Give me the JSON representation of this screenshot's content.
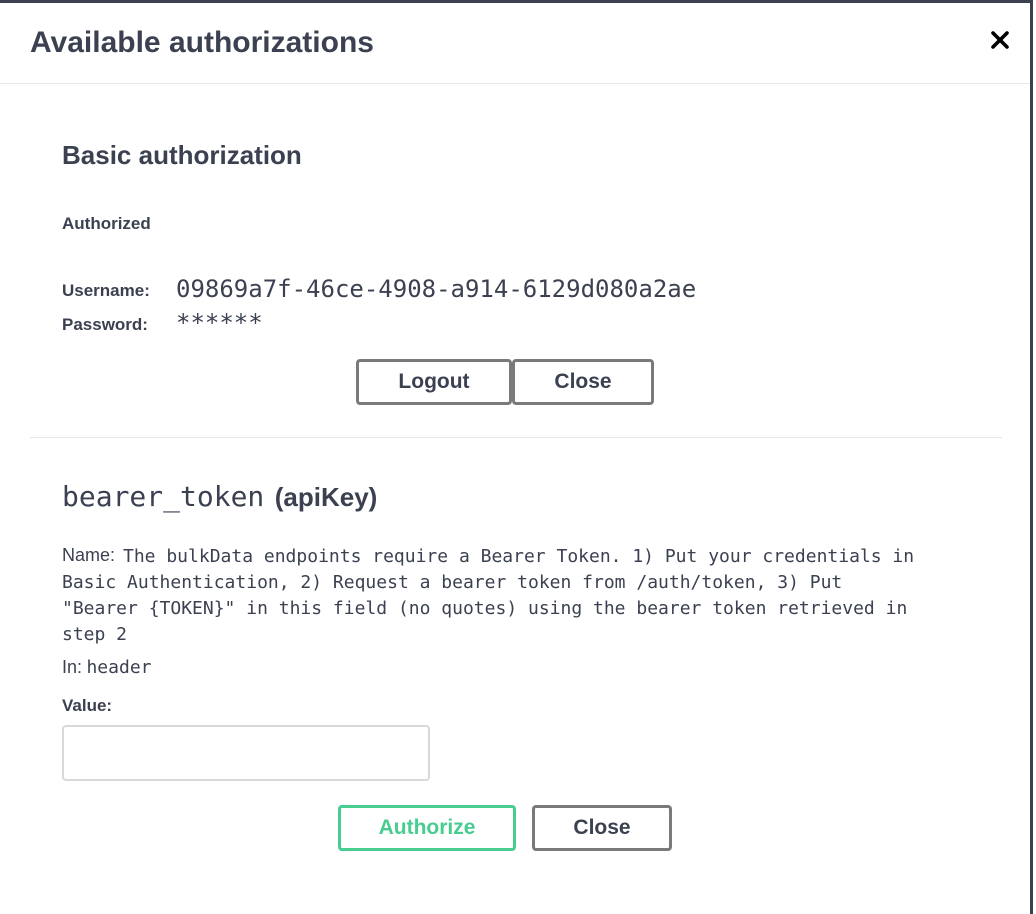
{
  "dialog": {
    "title": "Available authorizations",
    "close_icon": "close-icon"
  },
  "basic": {
    "heading": "Basic authorization",
    "status": "Authorized",
    "username_label": "Username:",
    "username_value": "09869a7f-46ce-4908-a914-6129d080a2ae",
    "password_label": "Password:",
    "password_value": "******",
    "logout_label": "Logout",
    "close_label": "Close"
  },
  "bearer": {
    "heading_name": "bearer_token",
    "heading_type": "(apiKey)",
    "name_label": "Name:",
    "name_value_lines": [
      "The bulkData endpoints require a Bearer Token. 1) Put your credentials in",
      "Basic Authentication, 2) Request a bearer token from /auth/token, 3) Put",
      "\"Bearer {TOKEN}\" in this field (no quotes) using the bearer token retrieved in",
      "step 2"
    ],
    "in_label": "In:",
    "in_value": "header",
    "value_label": "Value:",
    "value_input": "",
    "value_placeholder": "",
    "authorize_label": "Authorize",
    "close_label": "Close"
  },
  "colors": {
    "text": "#3b4151",
    "authorize_green": "#49cc90",
    "button_border": "#7a7a7a"
  }
}
